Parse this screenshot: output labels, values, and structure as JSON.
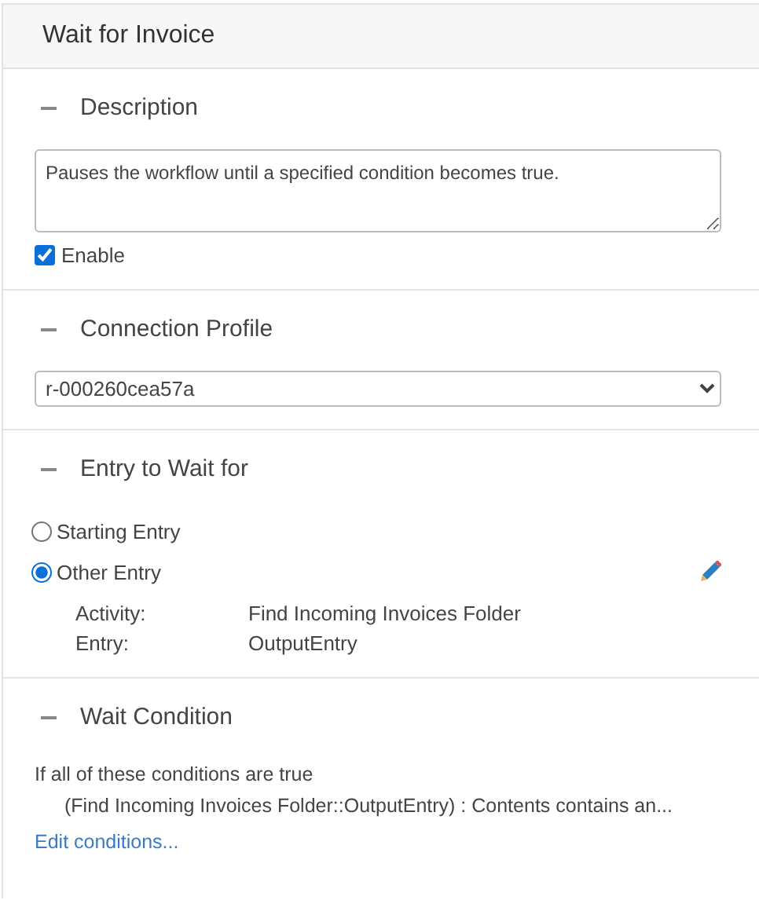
{
  "title": "Wait for Invoice",
  "sections": [
    {
      "kind": "description",
      "heading": "Description",
      "description": "Pauses the workflow until a specified condition becomes true.",
      "enable": {
        "label": "Enable",
        "checked": true
      }
    },
    {
      "kind": "profile",
      "heading": "Connection Profile",
      "profile": "r-000260cea57a"
    },
    {
      "kind": "entry",
      "heading": "Entry to Wait for",
      "options": [
        {
          "label": "Starting Entry",
          "selected": false
        },
        {
          "label": "Other Entry",
          "selected": true
        }
      ],
      "details": [
        {
          "label": "Activity:",
          "value": "Find Incoming Invoices Folder"
        },
        {
          "label": "Entry:",
          "value": "OutputEntry"
        }
      ]
    },
    {
      "kind": "condition",
      "heading": "Wait Condition",
      "summary": "If all of these conditions are true",
      "condition": "(Find Incoming Invoices Folder::OutputEntry) : Contents contains an...",
      "link": "Edit conditions..."
    }
  ]
}
